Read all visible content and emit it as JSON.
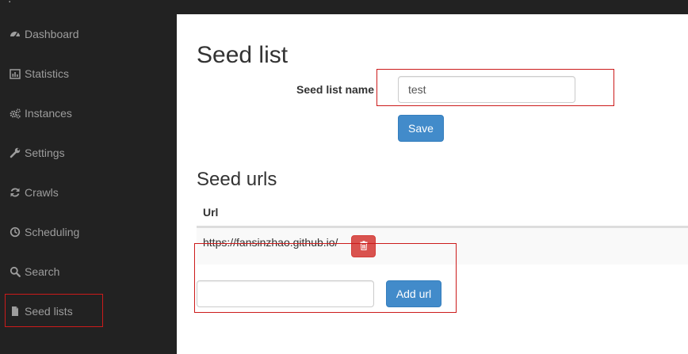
{
  "sidebar": {
    "items": [
      {
        "label": "Dashboard",
        "icon": "dashboard-icon"
      },
      {
        "label": "Statistics",
        "icon": "bar-chart-icon"
      },
      {
        "label": "Instances",
        "icon": "cogs-icon"
      },
      {
        "label": "Settings",
        "icon": "wrench-icon"
      },
      {
        "label": "Crawls",
        "icon": "refresh-icon"
      },
      {
        "label": "Scheduling",
        "icon": "clock-icon"
      },
      {
        "label": "Search",
        "icon": "search-icon"
      },
      {
        "label": "Seed lists",
        "icon": "file-icon"
      }
    ],
    "active": "Seed lists"
  },
  "main": {
    "title": "Seed list",
    "name_label": "Seed list name",
    "name_value": "test",
    "save_label": "Save",
    "urls_title": "Seed urls",
    "table_header": "Url",
    "urls": [
      "https://fansinzhao.github.io/"
    ],
    "new_url_value": "",
    "add_url_label": "Add url"
  },
  "colors": {
    "sidebar_bg": "#222222",
    "sidebar_text": "#9d9d9d",
    "primary": "#428bca",
    "danger": "#d9534f",
    "highlight_border": "#cc1b1b"
  }
}
